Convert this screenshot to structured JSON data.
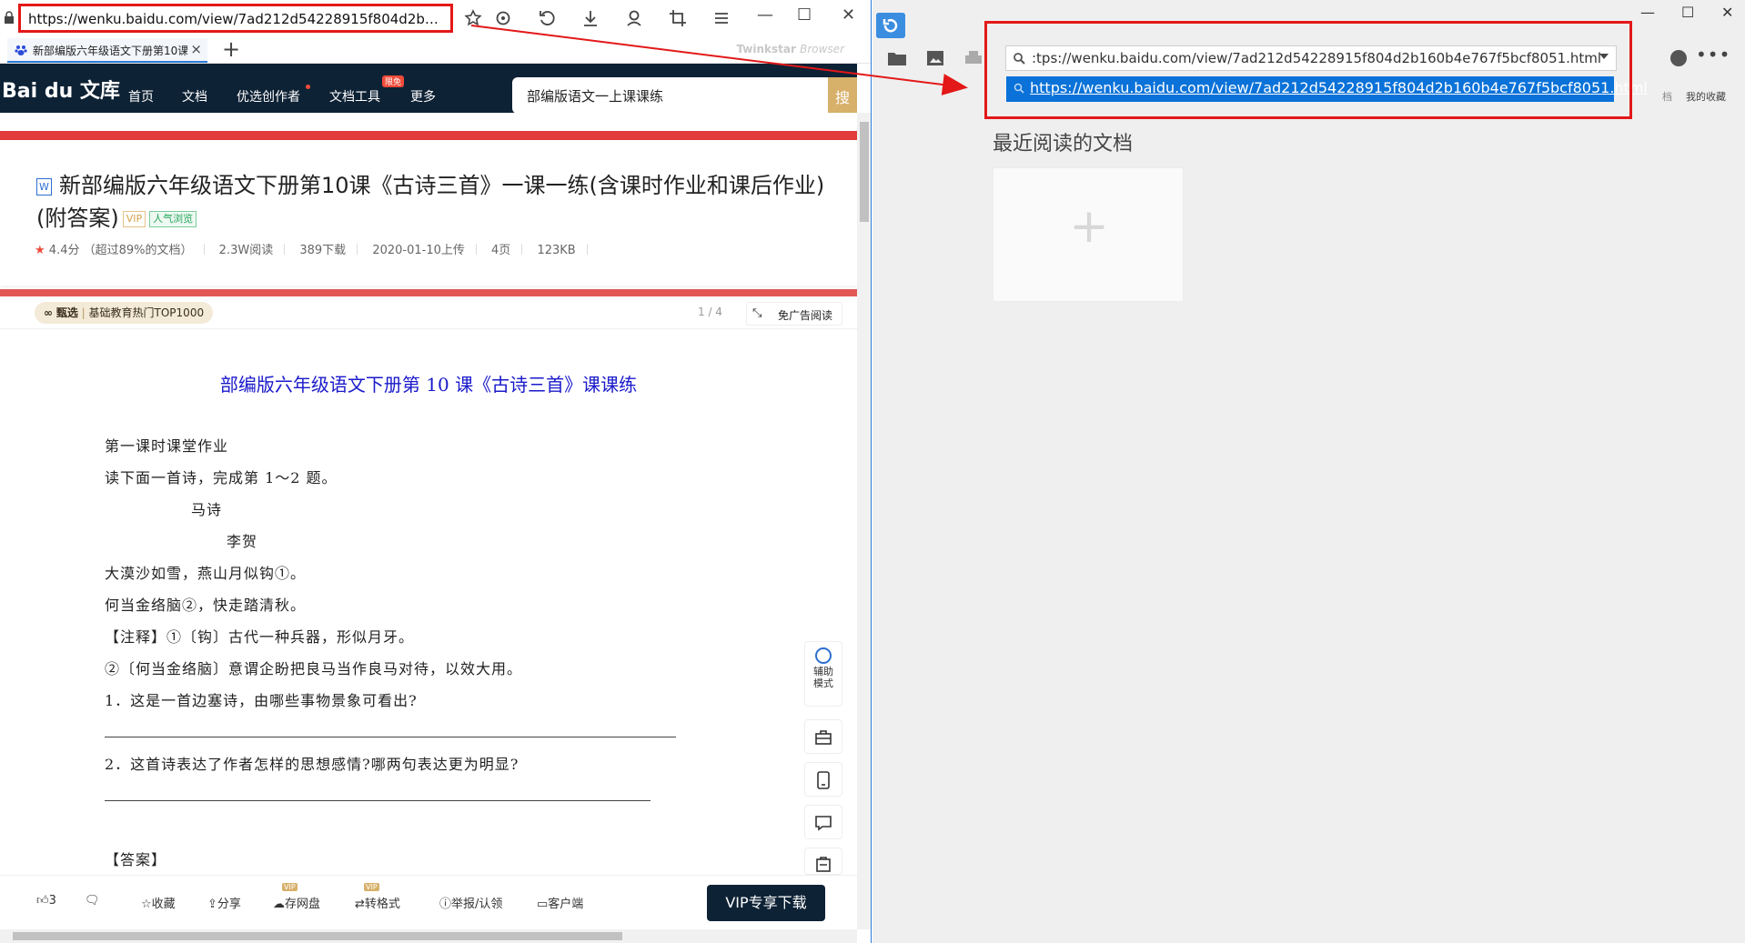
{
  "left_browser": {
    "url": "https://wenku.baidu.com/view/7ad212d54228915f804d2b160b4e7...",
    "tab_title": "新部编版六年级语文下册第10课",
    "tab_close": "×",
    "new_tab": "+",
    "brand": "Twinkstar",
    "brand_suffix": "Browser",
    "window_min": "—",
    "window_max": "☐",
    "window_close": "✕"
  },
  "wenku_nav": {
    "logo": "Bai du 文库",
    "items": [
      "首页",
      "文档",
      "优选创作者",
      "文档工具",
      "更多"
    ],
    "new_badge": "限免",
    "search_value": "部编版语文一上课课练",
    "search_btn": "搜"
  },
  "doc_header": {
    "file_type": "W",
    "title": "新部编版六年级语文下册第10课《古诗三首》一课一练(含课时作业和课后作业)(附答案)",
    "tag_vip": "VIP",
    "tag_hot": "人气浏览",
    "rating": "4.4分",
    "rating_note": "（超过89%的文档）",
    "reads": "2.3W阅读",
    "downloads": "389下载",
    "upload_date": "2020-01-10上传",
    "pages": "4页",
    "size": "123KB"
  },
  "doc_sub": {
    "select_label": "甄选",
    "select_note": "基础教育热门TOP1000",
    "page_indicator": "1 / 4",
    "adfree_label": "免广告阅读"
  },
  "doc_body": {
    "heading": "部编版六年级语文下册第 10 课《古诗三首》课课练",
    "lines": [
      "第一课时课堂作业",
      "读下面一首诗，完成第 1～2 题。",
      "马诗",
      "李贺",
      "大漠沙如雪，燕山月似钩①。",
      "何当金络脑②，快走踏清秋。",
      "【注释】①〔钩〕古代一种兵器，形似月牙。",
      "②〔何当金络脑〕意谓企盼把良马当作良马对待，以效大用。",
      "1．这是一首边塞诗，由哪些事物景象可看出?",
      "2．这首诗表达了作者怎样的思想感情?哪两句表达更为明显?",
      "【答案】"
    ]
  },
  "side_tools": {
    "assist_mode": "辅助模式"
  },
  "bottom_bar": {
    "like_count": "3",
    "collect": "收藏",
    "share": "分享",
    "save_cloud": "存网盘",
    "convert": "转格式",
    "report": "举报/认领",
    "client": "客户端",
    "vip_download": "VIP专享下载",
    "vip_badge": "VIP"
  },
  "right_app": {
    "address_value": ":tps://wenku.baidu.com/view/7ad212d54228915f804d2b160b4e767f5bcf8051.html",
    "suggestion": "https://wenku.baidu.com/view/7ad212d54228915f804d2b160b4e767f5bcf8051.html",
    "recent_title": "最近阅读的文档",
    "add_plus": "+",
    "my_collect": "我的收藏",
    "doc_label": "档",
    "more": "•••",
    "window_min": "—",
    "window_max": "☐",
    "window_close": "✕"
  },
  "colors": {
    "annotation_red": "#e31818",
    "wenku_dark": "#0e2235",
    "select_blue": "#0a72d8",
    "doc_heading_blue": "#1a1acb"
  }
}
